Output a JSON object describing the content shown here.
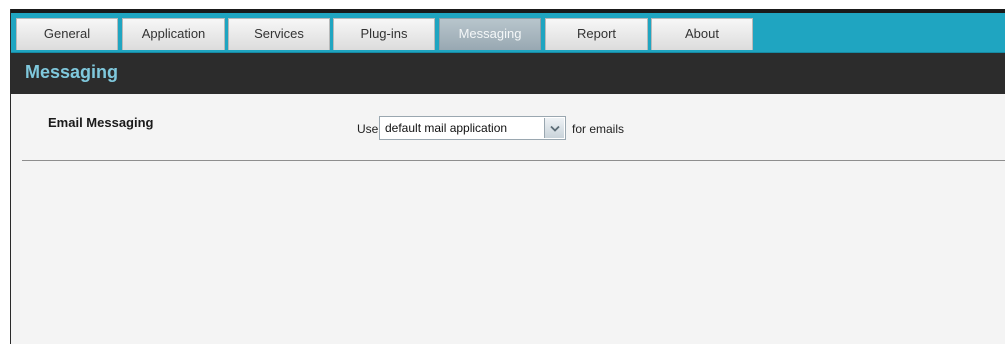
{
  "tabs": [
    {
      "label": "General",
      "active": false
    },
    {
      "label": "Application",
      "active": false
    },
    {
      "label": "Services",
      "active": false
    },
    {
      "label": "Plug-ins",
      "active": false
    },
    {
      "label": "Messaging",
      "active": true
    },
    {
      "label": "Report",
      "active": false
    },
    {
      "label": "About",
      "active": false
    }
  ],
  "header": {
    "title": "Messaging"
  },
  "email": {
    "section_label": "Email Messaging",
    "prefix": "Use",
    "selected_option": "default mail application",
    "suffix": "for emails"
  },
  "colors": {
    "tab_bar": "#1fa5c1",
    "header_bg": "#2c2c2c",
    "header_title": "#7fc8dc",
    "content_bg": "#f4f4f4"
  },
  "icons": {
    "dropdown": "chevron-down-icon"
  }
}
